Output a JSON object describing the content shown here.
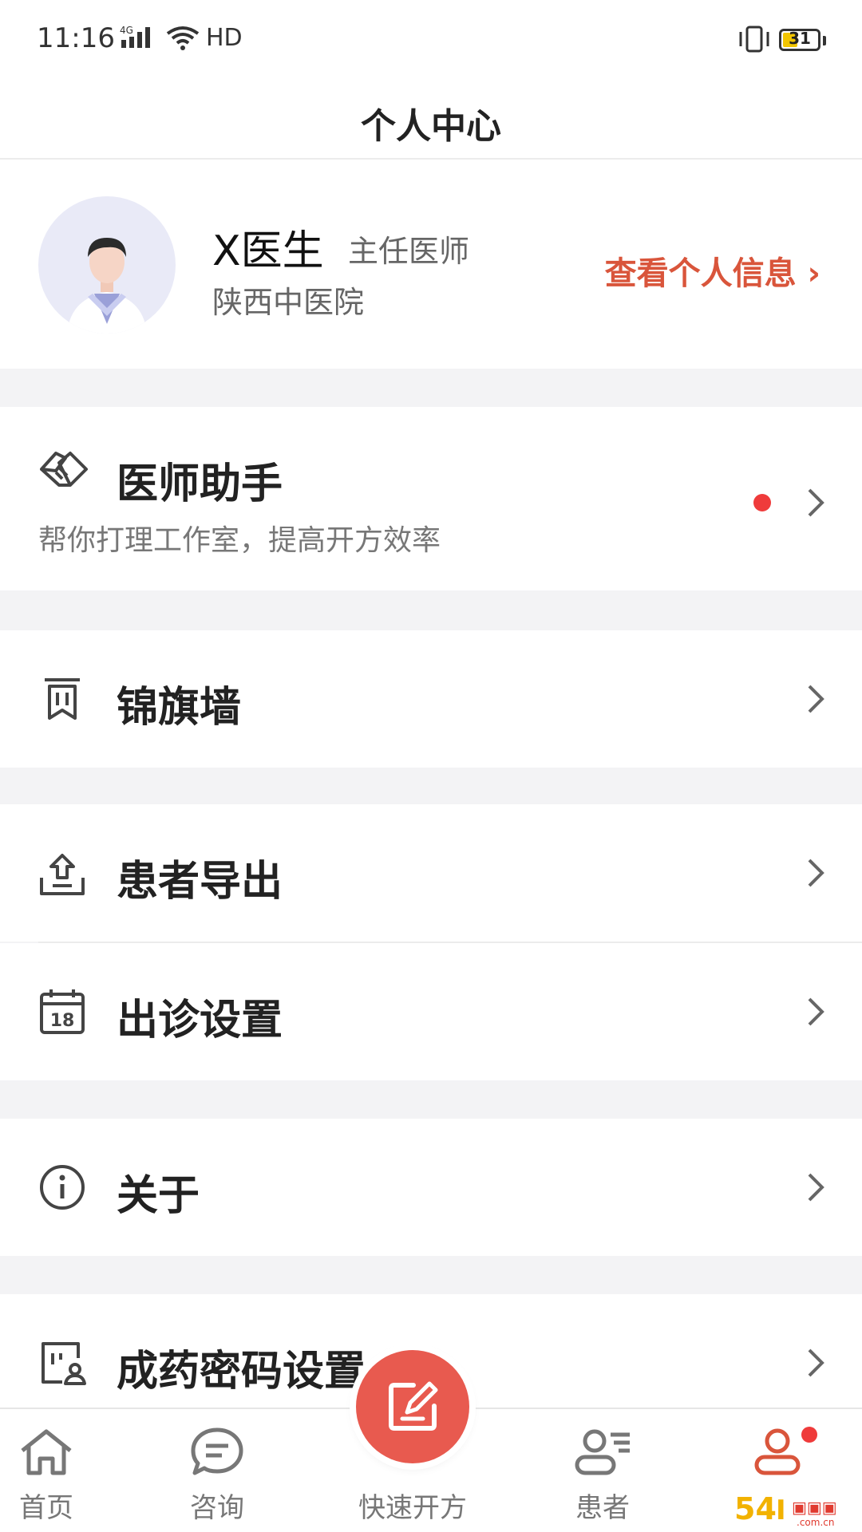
{
  "status_bar": {
    "time": "11:16",
    "network": "4G",
    "hd": "HD",
    "battery": "31"
  },
  "header": {
    "title": "个人中心"
  },
  "profile": {
    "name": "X医生",
    "title": "主任医师",
    "hospital": "陕西中医院",
    "view_info": "查看个人信息 ›"
  },
  "menu": {
    "assistant": {
      "label": "医师助手",
      "subtitle": "帮你打理工作室，提高开方效率",
      "icon": "handshake-icon",
      "has_dot": true
    },
    "banner_wall": {
      "label": "锦旗墙",
      "icon": "banner-icon"
    },
    "patient_export": {
      "label": "患者导出",
      "icon": "export-icon"
    },
    "clinic_settings": {
      "label": "出诊设置",
      "icon": "calendar-icon",
      "calendar_day": "18"
    },
    "about": {
      "label": "关于",
      "icon": "info-icon"
    },
    "medicine_password": {
      "label": "成药密码设置",
      "icon": "password-id-icon"
    }
  },
  "tabbar": {
    "items": [
      {
        "label": "首页",
        "icon": "home-icon"
      },
      {
        "label": "咨询",
        "icon": "chat-icon"
      },
      {
        "label": "快速开方",
        "icon": "edit-prescription-icon"
      },
      {
        "label": "患者",
        "icon": "patients-icon"
      },
      {
        "label": "",
        "icon": "profile-icon",
        "active": true
      }
    ]
  },
  "colors": {
    "accent": "#d9553b",
    "fab": "#e85a4f",
    "red_dot": "#ef3b3b",
    "background": "#f3f3f5"
  }
}
